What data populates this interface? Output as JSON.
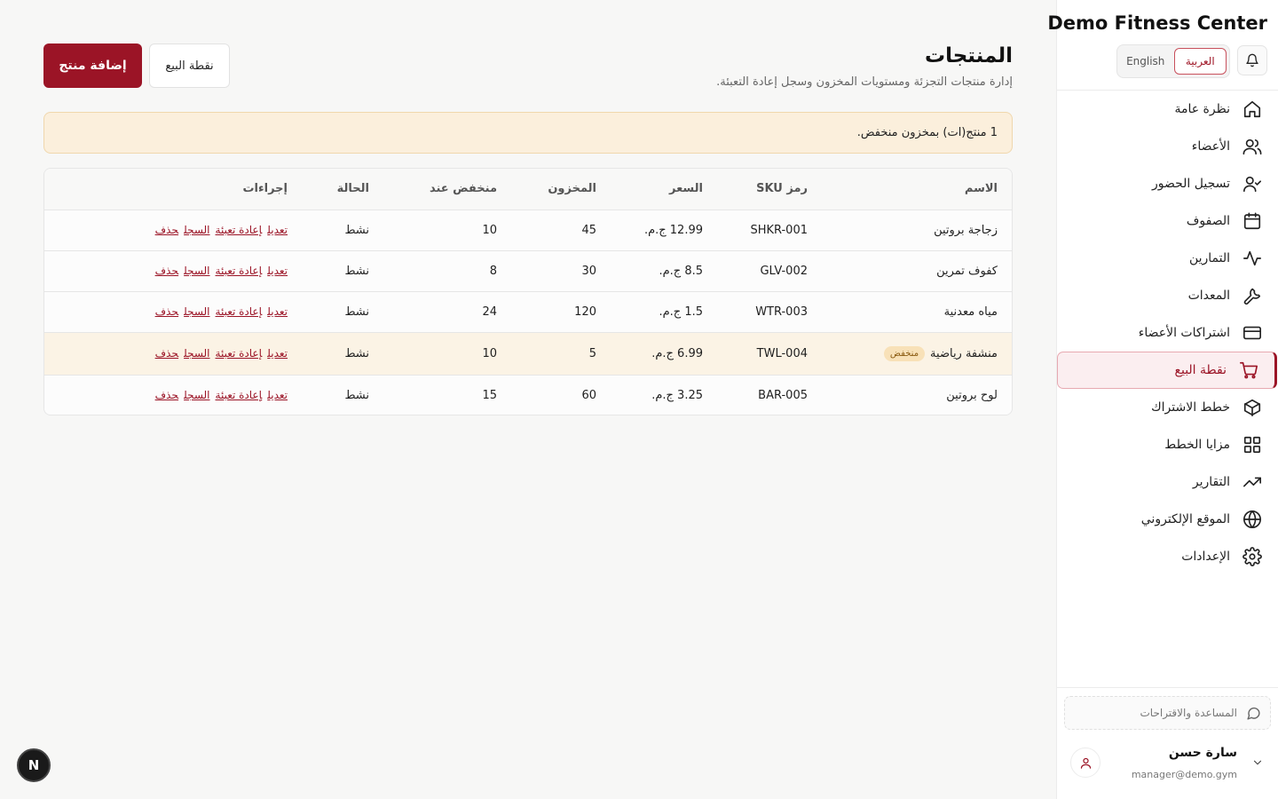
{
  "app": {
    "brand": "Demo Fitness Center",
    "lang_arabic": "العربية",
    "lang_english": "English"
  },
  "sidebar": {
    "items": [
      {
        "label": "نظرة عامة",
        "icon": "home-icon"
      },
      {
        "label": "الأعضاء",
        "icon": "users-icon"
      },
      {
        "label": "تسجيل الحضور",
        "icon": "user-check-icon"
      },
      {
        "label": "الصفوف",
        "icon": "calendar-icon"
      },
      {
        "label": "التمارين",
        "icon": "activity-icon"
      },
      {
        "label": "المعدات",
        "icon": "wrench-icon"
      },
      {
        "label": "اشتراكات الأعضاء",
        "icon": "credit-card-icon"
      },
      {
        "label": "نقطة البيع",
        "icon": "cart-icon",
        "active": true
      },
      {
        "label": "خطط الاشتراك",
        "icon": "package-icon"
      },
      {
        "label": "مزايا الخطط",
        "icon": "grid-icon"
      },
      {
        "label": "التقارير",
        "icon": "trending-up-icon"
      },
      {
        "label": "الموقع الإلكتروني",
        "icon": "globe-icon"
      },
      {
        "label": "الإعدادات",
        "icon": "settings-icon"
      }
    ],
    "help": "المساعدة والاقتراحات",
    "user_name": "سارة حسن",
    "user_email": "manager@demo.gym"
  },
  "page": {
    "title": "المنتجات",
    "subtitle": "إدارة منتجات التجزئة ومستويات المخزون وسجل إعادة التعبئة.",
    "add_button": "إضافة منتج",
    "pos_button": "نقطة البيع",
    "alert": "1 منتج(ات) بمخزون منخفض."
  },
  "table": {
    "headers": {
      "name": "الاسم",
      "sku": "رمز SKU",
      "price": "السعر",
      "stock": "المخزون",
      "low_at": "منخفض عند",
      "status": "الحالة",
      "actions": "إجراءات"
    },
    "low_badge": "منخفض",
    "actions": {
      "edit": "تعديل",
      "restock": "إعادة تعبئة",
      "log": "السجل",
      "delete": "حذف"
    },
    "rows": [
      {
        "name": "زجاجة بروتين",
        "sku": "SHKR-001",
        "price": "12.99 ج.م.",
        "stock": "45",
        "low_at": "10",
        "status": "نشط",
        "low": false
      },
      {
        "name": "كفوف تمرين",
        "sku": "GLV-002",
        "price": "8.5 ج.م.",
        "stock": "30",
        "low_at": "8",
        "status": "نشط",
        "low": false
      },
      {
        "name": "مياه معدنية",
        "sku": "WTR-003",
        "price": "1.5 ج.م.",
        "stock": "120",
        "low_at": "24",
        "status": "نشط",
        "low": false
      },
      {
        "name": "منشفة رياضية",
        "sku": "TWL-004",
        "price": "6.99 ج.م.",
        "stock": "5",
        "low_at": "10",
        "status": "نشط",
        "low": true
      },
      {
        "name": "لوح بروتين",
        "sku": "BAR-005",
        "price": "3.25 ج.م.",
        "stock": "60",
        "low_at": "15",
        "status": "نشط",
        "low": false
      }
    ]
  },
  "devtools": {
    "label": "N"
  },
  "colors": {
    "accent": "#9b1426",
    "alert_bg": "#fbefdc",
    "low_row_bg": "#fbf3e5"
  }
}
